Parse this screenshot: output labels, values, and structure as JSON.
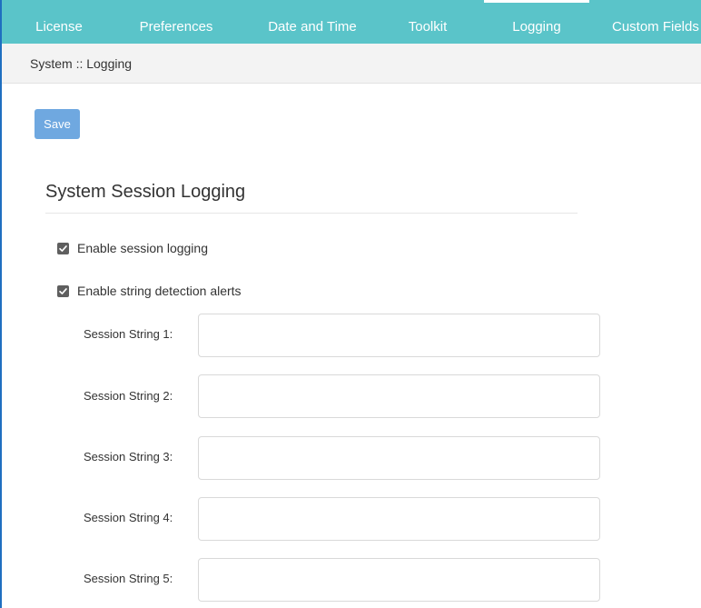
{
  "tabs": [
    {
      "label": "License",
      "active": false
    },
    {
      "label": "Preferences",
      "active": false
    },
    {
      "label": "Date and Time",
      "active": false
    },
    {
      "label": "Toolkit",
      "active": false
    },
    {
      "label": "Logging",
      "active": true
    },
    {
      "label": "Custom Fields",
      "active": false
    }
  ],
  "breadcrumb": "System :: Logging",
  "toolbar": {
    "save_label": "Save"
  },
  "section": {
    "title": "System Session Logging",
    "checkboxes": [
      {
        "label": "Enable session logging",
        "checked": true
      },
      {
        "label": "Enable string detection alerts",
        "checked": true
      }
    ],
    "fields": [
      {
        "label": "Session String 1:",
        "value": ""
      },
      {
        "label": "Session String 2:",
        "value": ""
      },
      {
        "label": "Session String 3:",
        "value": ""
      },
      {
        "label": "Session String 4:",
        "value": ""
      },
      {
        "label": "Session String 5:",
        "value": ""
      }
    ]
  },
  "colors": {
    "tabbar": "#5ac4c9",
    "save_button": "#6fa8e0",
    "checkbox": "#5f5f5f",
    "frame_border": "#1f6fc0"
  },
  "icons": {
    "checkbox_checked": "check-icon"
  }
}
